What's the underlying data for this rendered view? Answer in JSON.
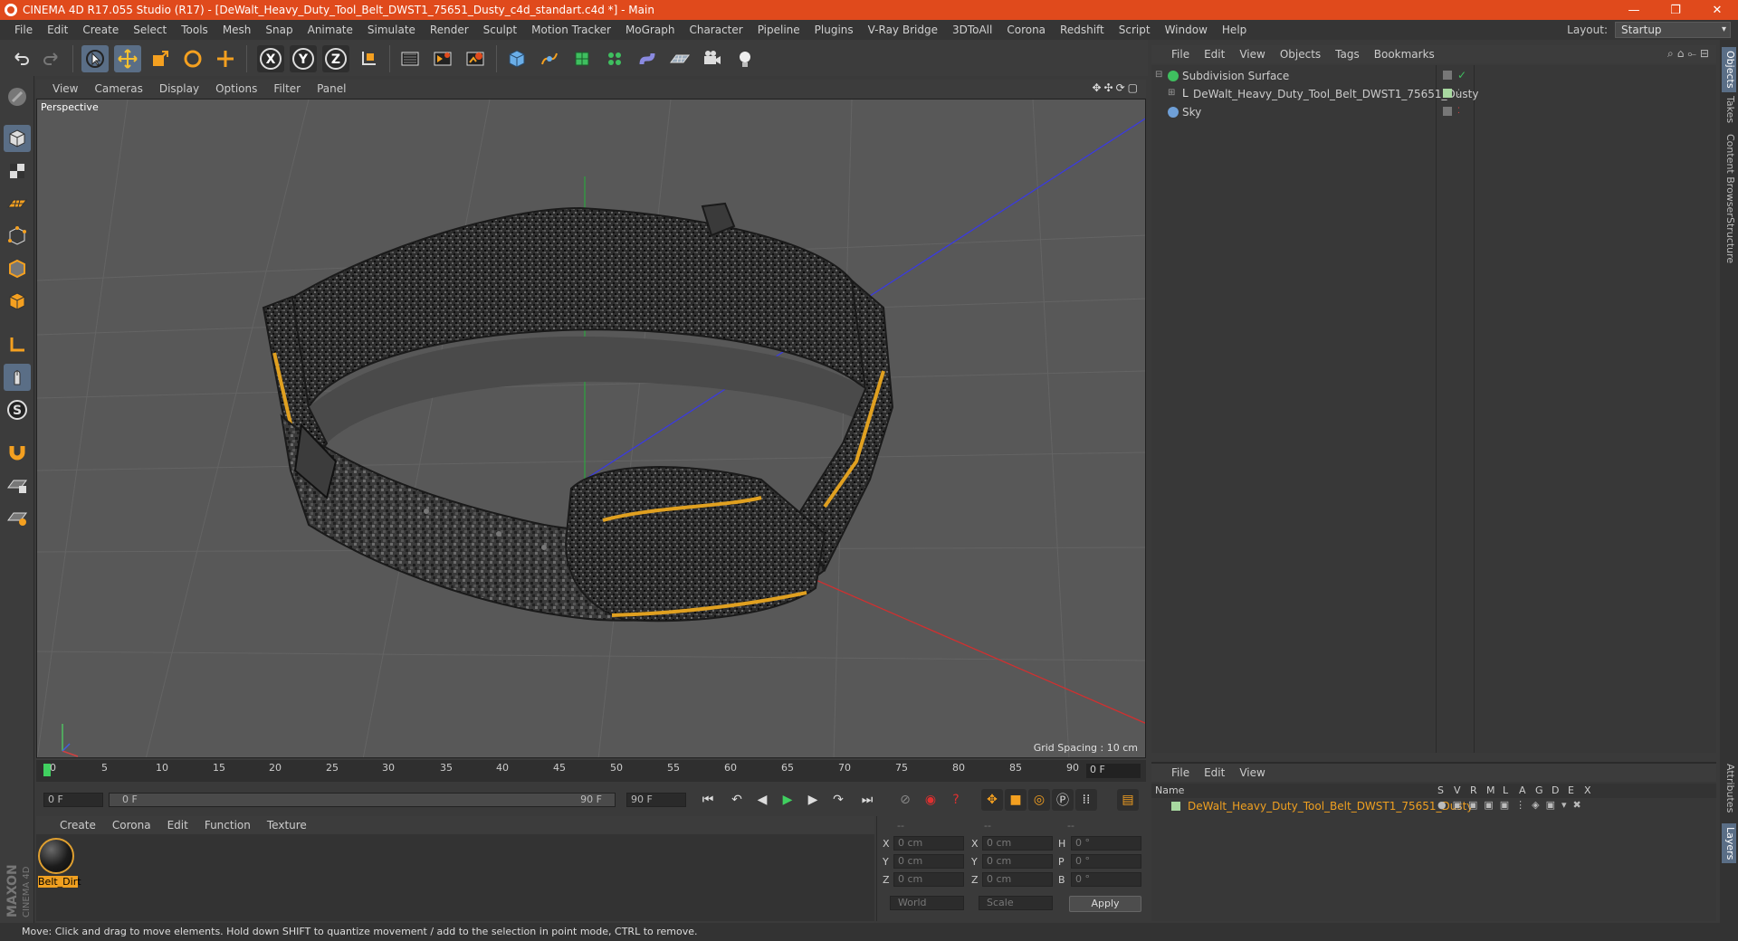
{
  "window": {
    "title": "CINEMA 4D R17.055 Studio (R17) - [DeWalt_Heavy_Duty_Tool_Belt_DWST1_75651_Dusty_c4d_standart.c4d *] - Main",
    "controls": [
      "minimize-icon",
      "restore-icon",
      "close-icon"
    ]
  },
  "menubar": {
    "items": [
      "File",
      "Edit",
      "Create",
      "Select",
      "Tools",
      "Mesh",
      "Snap",
      "Animate",
      "Simulate",
      "Render",
      "Sculpt",
      "Motion Tracker",
      "MoGraph",
      "Character",
      "Pipeline",
      "Plugins",
      "V-Ray Bridge",
      "3DToAll",
      "Corona",
      "Redshift",
      "Script",
      "Window",
      "Help"
    ],
    "layout_label": "Layout:",
    "layout_value": "Startup"
  },
  "toolbar": {
    "icons": [
      "undo-icon",
      "redo-icon",
      "select-arrow-icon",
      "move-icon",
      "scale-icon",
      "rotate-icon",
      "add-icon",
      "x-axis-icon",
      "y-axis-icon",
      "z-axis-icon",
      "coordinate-system-icon",
      "render-view-icon",
      "render-picture-viewer-icon",
      "edit-render-settings-icon",
      "cube-primitive-icon",
      "pen-spline-icon",
      "subdivision-icon",
      "cloner-icon",
      "deformer-icon",
      "floor-icon",
      "camera-icon",
      "light-icon"
    ],
    "axis_labels": [
      "X",
      "Y",
      "Z"
    ]
  },
  "leftbar": {
    "icons": [
      "make-editable-icon",
      "model-mode-icon",
      "texture-mode-icon",
      "workplane-icon",
      "points-mode-icon",
      "edges-mode-icon",
      "polygons-mode-icon",
      "axis-mode-icon",
      "tweak-icon",
      "solo-icon",
      "magnet-icon",
      "snap-grid-icon",
      "snap-settings-icon"
    ]
  },
  "viewport": {
    "menu": [
      "View",
      "Cameras",
      "Display",
      "Options",
      "Filter",
      "Panel"
    ],
    "label": "Perspective",
    "grid_spacing": "Grid Spacing : 10 cm"
  },
  "timeline": {
    "ticks": [
      "0",
      "5",
      "10",
      "15",
      "20",
      "25",
      "30",
      "35",
      "40",
      "45",
      "50",
      "55",
      "60",
      "65",
      "70",
      "75",
      "80",
      "85",
      "90"
    ],
    "current_frame": "0 F",
    "start_field": "0 F",
    "range_start": "0 F",
    "range_end": "90 F",
    "end_field": "90 F"
  },
  "material_manager": {
    "menu": [
      "Create",
      "Corona",
      "Edit",
      "Function",
      "Texture"
    ],
    "material_name": "Belt_Dirt"
  },
  "coordinates": {
    "header": [
      "--",
      "--",
      "--"
    ],
    "rows": [
      {
        "l1": "X",
        "v1": "0 cm",
        "l2": "X",
        "v2": "0 cm",
        "l3": "H",
        "v3": "0 °"
      },
      {
        "l1": "Y",
        "v1": "0 cm",
        "l2": "Y",
        "v2": "0 cm",
        "l3": "P",
        "v3": "0 °"
      },
      {
        "l1": "Z",
        "v1": "0 cm",
        "l2": "Z",
        "v2": "0 cm",
        "l3": "B",
        "v3": "0 °"
      }
    ],
    "world": "World",
    "scale": "Scale",
    "apply": "Apply"
  },
  "object_manager": {
    "menu": [
      "File",
      "Edit",
      "View",
      "Objects",
      "Tags",
      "Bookmarks"
    ],
    "objects": [
      {
        "name": "Subdivision Surface",
        "icon_color": "#3fbf5f"
      },
      {
        "name": "DeWalt_Heavy_Duty_Tool_Belt_DWST1_75651_Dusty",
        "icon_color": "#d8d8d8"
      },
      {
        "name": "Sky",
        "icon_color": "#6fa0d8"
      }
    ]
  },
  "layer_manager": {
    "menu": [
      "File",
      "Edit",
      "View"
    ],
    "header_name": "Name",
    "header_cols": [
      "S",
      "V",
      "R",
      "M",
      "L",
      "A",
      "G",
      "D",
      "E",
      "X"
    ],
    "row_name": "DeWalt_Heavy_Duty_Tool_Belt_DWST1_75651_Dusty",
    "row_color": "#a8d8a0"
  },
  "right_tabs": [
    "Objects",
    "Takes",
    "Content Browser",
    "Structure",
    "Attributes",
    "Layers"
  ],
  "status": "Move: Click and drag to move elements. Hold down SHIFT to quantize movement / add to the selection in point mode, CTRL to remove.",
  "logo": {
    "line1": "MAXON",
    "line2": "CINEMA 4D"
  },
  "colors": {
    "accent": "#e04a1c",
    "selection": "#5a6e86",
    "material_highlight": "#f0a020"
  }
}
